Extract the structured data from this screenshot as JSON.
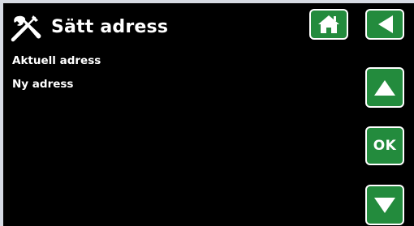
{
  "header": {
    "title": "Sätt adress",
    "icon": "tools-icon"
  },
  "fields": [
    {
      "label": "Aktuell adress"
    },
    {
      "label": "Ny adress"
    }
  ],
  "buttons": {
    "home_icon": "home-icon",
    "back_icon": "back-arrow-icon",
    "up_icon": "up-arrow-icon",
    "ok_label": "OK",
    "down_icon": "down-arrow-icon"
  },
  "colors": {
    "background": "#000000",
    "button_green": "#238b3d",
    "button_border": "#ffffff",
    "text": "#ffffff",
    "frame": "#d7dbe4"
  }
}
